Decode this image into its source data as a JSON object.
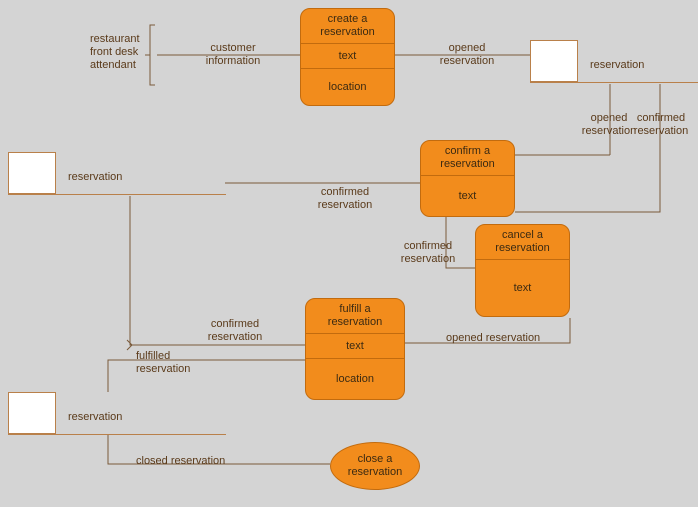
{
  "actor": {
    "label": "restaurant\nfront desk\nattendant"
  },
  "tasks": {
    "create": {
      "title": "create a\nreservation",
      "row1": "text",
      "row2": "location"
    },
    "confirm": {
      "title": "confirm a\nreservation",
      "row1": "text"
    },
    "cancel": {
      "title": "cancel a\nreservation",
      "row1": "text"
    },
    "fulfill": {
      "title": "fulfill a\nreservation",
      "row1": "text",
      "row2": "location"
    },
    "close": {
      "title": "close a\nreservation"
    }
  },
  "states": {
    "s1": {
      "label": "reservation"
    },
    "s2": {
      "label": "reservation"
    },
    "s3": {
      "label": "reservation"
    }
  },
  "edges": {
    "customer_info": "customer\ninformation",
    "opened_reservation_1": "opened\nreservation",
    "opened_reservation_2": "opened\nreservation",
    "opened_reservation_3": "opened reservation",
    "confirmed_1": "confirmed\nreservation",
    "confirmed_2": "confirmed\nreservation",
    "confirmed_3": "confirmed\nreservation",
    "confirmed_4": "confirmed\nreservation",
    "fulfilled": "fulfilled\nreservation",
    "closed": "closed reservation"
  }
}
